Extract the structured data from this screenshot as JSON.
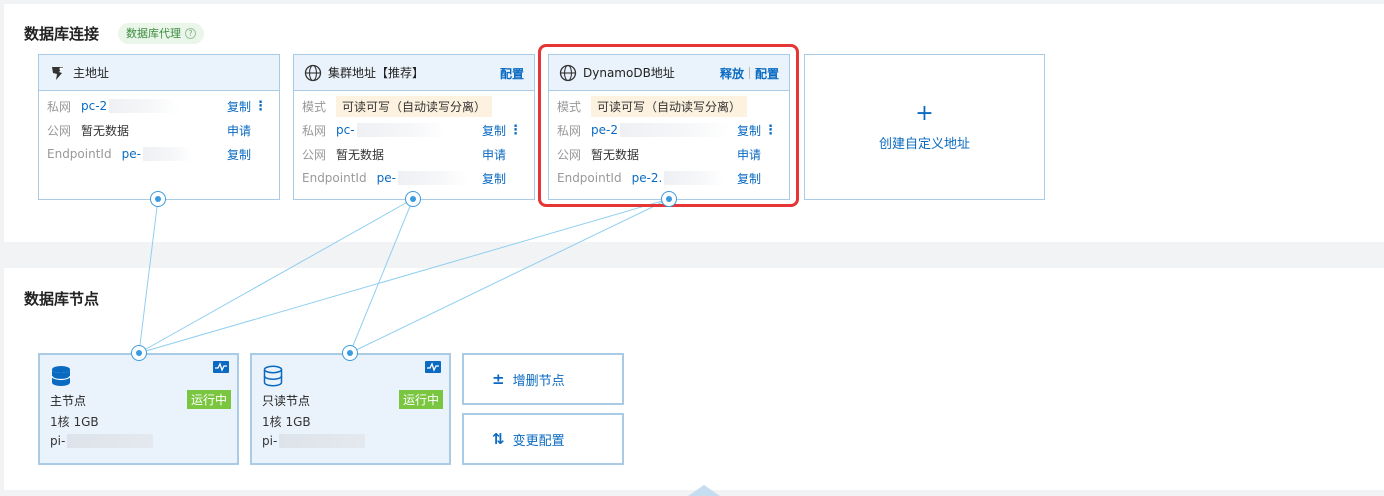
{
  "connections": {
    "title": "数据库连接",
    "proxy_badge": "数据库代理",
    "primary": {
      "title": "主地址",
      "rows": [
        {
          "label": "私网",
          "value": "pc-2",
          "action": "复制"
        },
        {
          "label": "公网",
          "value": "暂无数据",
          "action": "申请"
        },
        {
          "label": "EndpointId",
          "value": "pe-",
          "action": "复制"
        }
      ]
    },
    "cluster": {
      "title": "集群地址【推荐】",
      "config_label": "配置",
      "mode_label": "模式",
      "mode_value": "可读可写（自动读写分离）",
      "rows": [
        {
          "label": "私网",
          "value": "pc-",
          "action": "复制"
        },
        {
          "label": "公网",
          "value": "暂无数据",
          "action": "申请"
        },
        {
          "label": "EndpointId",
          "value": "pe-",
          "action": "复制"
        }
      ]
    },
    "dynamodb": {
      "title": "DynamoDB地址",
      "release_label": "释放",
      "config_label": "配置",
      "mode_label": "模式",
      "mode_value": "可读可写（自动读写分离）",
      "rows": [
        {
          "label": "私网",
          "value": "pe-2",
          "action": "复制"
        },
        {
          "label": "公网",
          "value": "暂无数据",
          "action": "申请"
        },
        {
          "label": "EndpointId",
          "value": "pe-2.",
          "action": "复制"
        }
      ]
    },
    "create": {
      "icon": "+",
      "label": "创建自定义地址"
    }
  },
  "nodes": {
    "title": "数据库节点",
    "primary": {
      "name": "主节点",
      "spec": "1核 1GB",
      "id": "pi-",
      "status": "运行中"
    },
    "readonly": {
      "name": "只读节点",
      "spec": "1核 1GB",
      "id": "pi-",
      "status": "运行中"
    },
    "add_remove": {
      "icon": "±",
      "label": "增删节点"
    },
    "change_config": {
      "icon": "⇅",
      "label": "变更配置"
    }
  },
  "colors": {
    "accent": "#0a6ac2",
    "running": "#7bc640",
    "highlight": "#e53535",
    "line": "#8fcff0"
  }
}
